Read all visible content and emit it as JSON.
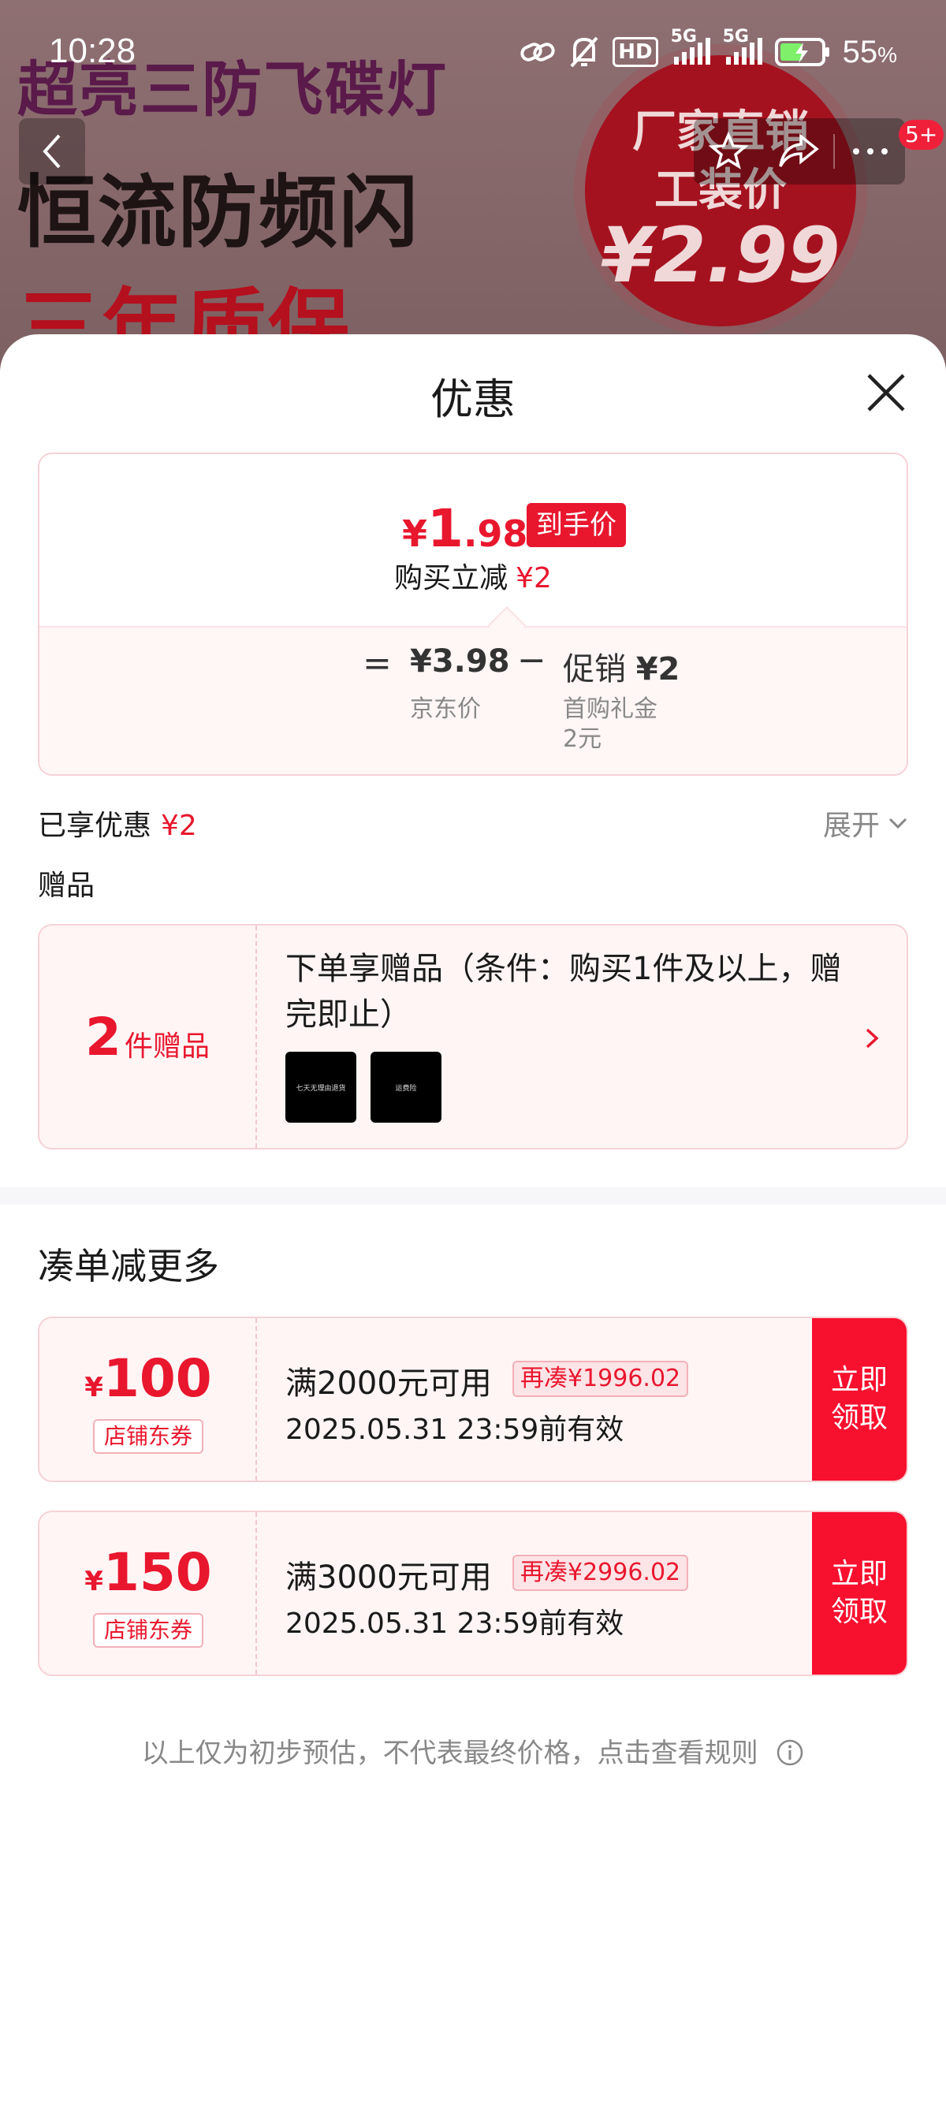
{
  "status_bar": {
    "time": "10:28",
    "network_1": "5G",
    "network_2": "5G",
    "hd_label": "HD",
    "battery_percent": "55",
    "battery_unit": "%"
  },
  "banner": {
    "line1": "超亮三防飞碟灯",
    "line2": "恒流防频闪",
    "line3": "三年质保",
    "badge_line1": "厂家直销",
    "badge_line2": "工装价",
    "badge_price": "¥2.99"
  },
  "nav": {
    "cart_badge": "5+"
  },
  "sheet": {
    "title": "优惠"
  },
  "price_card": {
    "currency": "¥",
    "final_int": "1",
    "final_dec": ".98",
    "tag": "到手价",
    "buy_reduce_label": "购买立减",
    "buy_reduce_value": "¥2",
    "equals": "=",
    "jd_price": "¥3.98",
    "jd_label": "京东价",
    "minus": "−",
    "promo_label": "促销",
    "promo_value": "¥2",
    "promo_sub1": "首购礼金",
    "promo_sub2": "2元"
  },
  "summary": {
    "enjoyed_label": "已享优惠",
    "enjoyed_value": "¥2",
    "expand_label": "展开",
    "gift_heading": "赠品"
  },
  "gift": {
    "count": "2",
    "unit": "件赠品",
    "description": "下单享赠品（条件：购买1件及以上，赠完即止）",
    "thumb1_text": "七天无理由退货",
    "thumb2_text": "运费险"
  },
  "more": {
    "heading": "凑单减更多"
  },
  "coupons": [
    {
      "currency": "¥",
      "amount": "100",
      "tag": "店铺东券",
      "condition": "满2000元可用",
      "need": "再凑¥1996.02",
      "date": "2025.05.31 23:59前有效",
      "button": "立即领取"
    },
    {
      "currency": "¥",
      "amount": "150",
      "tag": "店铺东券",
      "condition": "满3000元可用",
      "need": "再凑¥2996.02",
      "date": "2025.05.31 23:59前有效",
      "button": "立即领取"
    }
  ],
  "disclaimer": "以上仅为初步预估，不代表最终价格，点击查看规则",
  "colors": {
    "accent_red": "#e8172e",
    "button_red": "#f8102f",
    "muted_text": "#888888"
  }
}
